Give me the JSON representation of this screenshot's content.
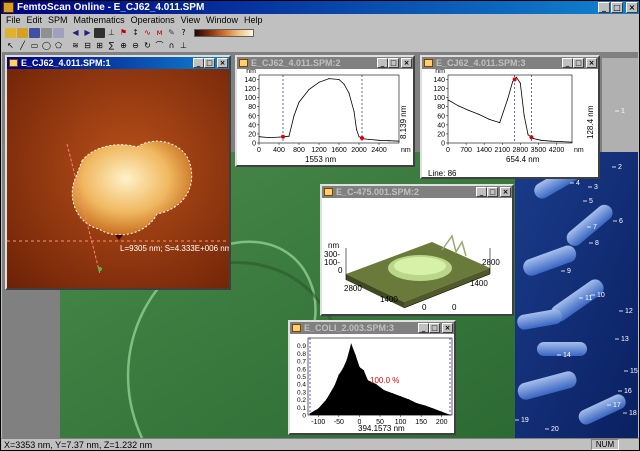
{
  "app": {
    "title": "FemtoScan Online - E_CJ62_4.011.SPM",
    "menu": [
      "File",
      "Edit",
      "SPM",
      "Mathematics",
      "Operations",
      "View",
      "Window",
      "Help"
    ],
    "status": "X=3353 nm, Y=7.37 nm, Z=1.232 nm",
    "num": "NUM",
    "colors": {
      "titlebar": "#000080",
      "face": "#c0c0c0"
    }
  },
  "windows": {
    "afm": {
      "title": "E_CJ62_4.011.SPM:1",
      "measure_label": "L=9305 nm; S=4.333E+006 nm×nm"
    },
    "profile1": {
      "title": "E_CJ62_4.011.SPM:2",
      "y_unit": "nm",
      "x_unit": "nm",
      "marker_dx": "1553 nm",
      "marker_dy": "8.139 nm"
    },
    "profile2": {
      "title": "E_CJ62_4.011.SPM:3",
      "y_unit": "nm",
      "x_unit": "nm",
      "marker_dx": "654.4 nm",
      "marker_dy": "128.4 nm",
      "line_label": "Line: 86"
    },
    "view3d": {
      "title": "E_C-475.001.SPM:2",
      "z_unit": "nm",
      "z_ticks": [
        "300-",
        "100-",
        "0"
      ],
      "x_tick_left": "2800",
      "x_tick_mid": "1400",
      "x_tick_zero": "0",
      "y_ticks": [
        "2800",
        "1400",
        "0"
      ]
    },
    "histogram": {
      "title": "E_COLI_2.003.SPM:3",
      "x_value": "394.1573 nm",
      "percent": "100.0 %"
    },
    "ecoli_labels": [
      "1",
      "2",
      "3",
      "4",
      "5",
      "6",
      "7",
      "8",
      "9",
      "10",
      "11",
      "12",
      "13",
      "14",
      "15",
      "16",
      "17",
      "18",
      "19",
      "20"
    ]
  },
  "chart_data": [
    {
      "type": "line",
      "title": "",
      "xlabel": "nm",
      "ylabel": "nm",
      "x_ticks": [
        "0",
        "400",
        "800",
        "1200",
        "1600",
        "2000",
        "2400"
      ],
      "y_ticks": [
        "0",
        "20",
        "40",
        "60",
        "80",
        "100",
        "120",
        "140"
      ],
      "xlim": [
        0,
        2800
      ],
      "ylim": [
        0,
        150
      ],
      "x": [
        0,
        200,
        400,
        600,
        700,
        800,
        1000,
        1200,
        1400,
        1600,
        1700,
        1800,
        1900,
        1950,
        2000,
        2100,
        2200,
        2400,
        2600,
        2800
      ],
      "y": [
        14,
        12,
        13,
        15,
        60,
        90,
        118,
        134,
        142,
        140,
        130,
        110,
        70,
        30,
        14,
        9,
        8,
        6,
        5,
        4
      ],
      "markers_x": [
        480,
        2060
      ]
    },
    {
      "type": "line",
      "title": "",
      "xlabel": "nm",
      "ylabel": "nm",
      "x_ticks": [
        "0",
        "700",
        "1400",
        "2100",
        "2800",
        "3500",
        "4200"
      ],
      "y_ticks": [
        "0",
        "20",
        "40",
        "60",
        "80",
        "100",
        "120",
        "140"
      ],
      "xlim": [
        0,
        4800
      ],
      "ylim": [
        0,
        150
      ],
      "x": [
        0,
        400,
        800,
        1200,
        1600,
        2000,
        2300,
        2500,
        2650,
        2800,
        2950,
        3100,
        3300,
        3600,
        4000,
        4400,
        4800
      ],
      "y": [
        95,
        82,
        72,
        63,
        52,
        45,
        95,
        135,
        145,
        132,
        60,
        18,
        10,
        6,
        4,
        3,
        2
      ],
      "markers_x": [
        2580,
        3230
      ]
    },
    {
      "type": "area",
      "title": "",
      "x_ticks": [
        "-100",
        "-50",
        "0",
        "50",
        "100",
        "150",
        "200"
      ],
      "y_ticks": [
        "0",
        "0.1",
        "0.2",
        "0.3",
        "0.4",
        "0.5",
        "0.6",
        "0.7",
        "0.8",
        "0.9"
      ],
      "xlim": [
        -125,
        225
      ],
      "ylim": [
        0,
        1.0
      ],
      "x": [
        -120,
        -100,
        -80,
        -60,
        -50,
        -40,
        -30,
        -20,
        -10,
        0,
        10,
        20,
        40,
        60,
        80,
        100,
        120,
        140,
        160,
        180,
        200,
        220
      ],
      "y": [
        0.02,
        0.08,
        0.2,
        0.38,
        0.52,
        0.6,
        0.72,
        0.92,
        0.78,
        0.62,
        0.58,
        0.45,
        0.4,
        0.32,
        0.28,
        0.24,
        0.2,
        0.15,
        0.12,
        0.08,
        0.04,
        0.0
      ]
    }
  ]
}
